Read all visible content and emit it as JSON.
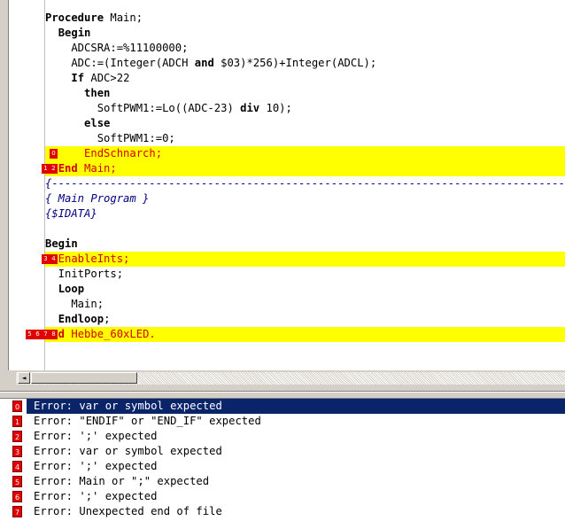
{
  "code": {
    "lines": [
      {
        "parts": [
          {
            "t": "Procedure",
            "k": true
          },
          {
            "t": " Main;"
          }
        ]
      },
      {
        "parts": [
          {
            "t": "  "
          },
          {
            "t": "Begin",
            "k": true
          }
        ]
      },
      {
        "parts": [
          {
            "t": "    ADCSRA:=%11100000;"
          }
        ]
      },
      {
        "parts": [
          {
            "t": "    ADC:=(Integer(ADCH "
          },
          {
            "t": "and",
            "k": true
          },
          {
            "t": " $03)*256)+Integer(ADCL);"
          }
        ]
      },
      {
        "parts": [
          {
            "t": "    "
          },
          {
            "t": "If",
            "k": true
          },
          {
            "t": " ADC>22"
          }
        ]
      },
      {
        "parts": [
          {
            "t": "      "
          },
          {
            "t": "then",
            "k": true
          }
        ]
      },
      {
        "parts": [
          {
            "t": "        SoftPWM1:=Lo((ADC-23) "
          },
          {
            "t": "div",
            "k": true
          },
          {
            "t": " 10);"
          }
        ]
      },
      {
        "parts": [
          {
            "t": "      "
          },
          {
            "t": "else",
            "k": true
          }
        ]
      },
      {
        "parts": [
          {
            "t": "        SoftPWM1:=0;"
          }
        ]
      },
      {
        "hl": true,
        "err": true,
        "markers": [
          "0"
        ],
        "parts": [
          {
            "t": "      EndSchnarch;"
          }
        ]
      },
      {
        "hl": true,
        "err": true,
        "markers": [
          "1",
          "2"
        ],
        "parts": [
          {
            "t": "  "
          },
          {
            "t": "End",
            "k": true
          },
          {
            "t": " Main;"
          }
        ]
      },
      {
        "parts": [
          {
            "t": "{-------------------------------------------------------------------------------",
            "c": true
          }
        ]
      },
      {
        "parts": [
          {
            "t": "{ Main Program }",
            "c": true
          }
        ]
      },
      {
        "parts": [
          {
            "t": "{$IDATA}",
            "c": true
          }
        ]
      },
      {
        "parts": [
          {
            "t": ""
          }
        ]
      },
      {
        "parts": [
          {
            "t": "Begin",
            "k": true
          }
        ]
      },
      {
        "hl": true,
        "err": true,
        "markers": [
          "3",
          "4"
        ],
        "parts": [
          {
            "t": "  EnableInts;"
          }
        ]
      },
      {
        "parts": [
          {
            "t": "  InitPorts;"
          }
        ]
      },
      {
        "parts": [
          {
            "t": "  "
          },
          {
            "t": "Loop",
            "k": true
          }
        ]
      },
      {
        "parts": [
          {
            "t": "    Main;"
          }
        ]
      },
      {
        "parts": [
          {
            "t": "  "
          },
          {
            "t": "Endloop",
            "k": true
          },
          {
            "t": ";"
          }
        ]
      },
      {
        "hl": true,
        "err": true,
        "markers": [
          "5",
          "6",
          "7",
          "8"
        ],
        "parts": [
          {
            "t": "End",
            "k": true
          },
          {
            "t": " Hebbe_60xLED."
          }
        ]
      }
    ]
  },
  "messages": [
    {
      "num": "0",
      "text": "Error: var or symbol expected",
      "selected": true
    },
    {
      "num": "1",
      "text": "Error: \"ENDIF\" or \"END_IF\" expected"
    },
    {
      "num": "2",
      "text": "Error: ';' expected"
    },
    {
      "num": "3",
      "text": "Error: var or symbol expected"
    },
    {
      "num": "4",
      "text": "Error: ';' expected"
    },
    {
      "num": "5",
      "text": "Error: Main or \";\" expected"
    },
    {
      "num": "6",
      "text": "Error: ';' expected"
    },
    {
      "num": "7",
      "text": "Error: Unexpected end of file"
    }
  ],
  "icons": {
    "scroll_left": "scroll-left-arrow-icon",
    "error_marker": "error-marker-icon"
  },
  "colors": {
    "highlight": "#ffff00",
    "error_text": "#d40000",
    "keyword": "#000000",
    "comment": "#000080",
    "selection": "#0a246a",
    "marker": "#e00000"
  }
}
